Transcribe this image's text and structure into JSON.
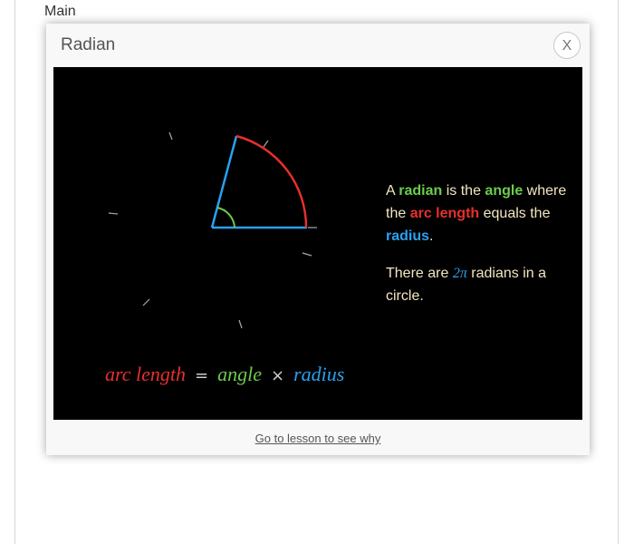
{
  "page": {
    "main_label": "Main"
  },
  "modal": {
    "title": "Radian",
    "close_label": "X",
    "footer_link": "Go to lesson to see why"
  },
  "explanation": {
    "p1": {
      "a": "A",
      "radian": "radian",
      "is_the": "is the",
      "angle": "angle",
      "where_the": "where the",
      "arc_length": "arc length",
      "equals_the": "equals the",
      "radius": "radius",
      "period": "."
    },
    "p2": {
      "there_are": "There are",
      "two_pi": "2π",
      "rest": "radians in a circle."
    }
  },
  "formula": {
    "arc": "arc length",
    "equals": "=",
    "angle": "angle",
    "times": "×",
    "radius": "radius"
  },
  "colors": {
    "arc": "#e6302a",
    "angle": "#6ccc4c",
    "radius": "#2aa0f0",
    "text": "#f2e6c2",
    "tick": "#aaaaaa",
    "background": "#000000"
  },
  "icons": [
    "close-icon"
  ]
}
